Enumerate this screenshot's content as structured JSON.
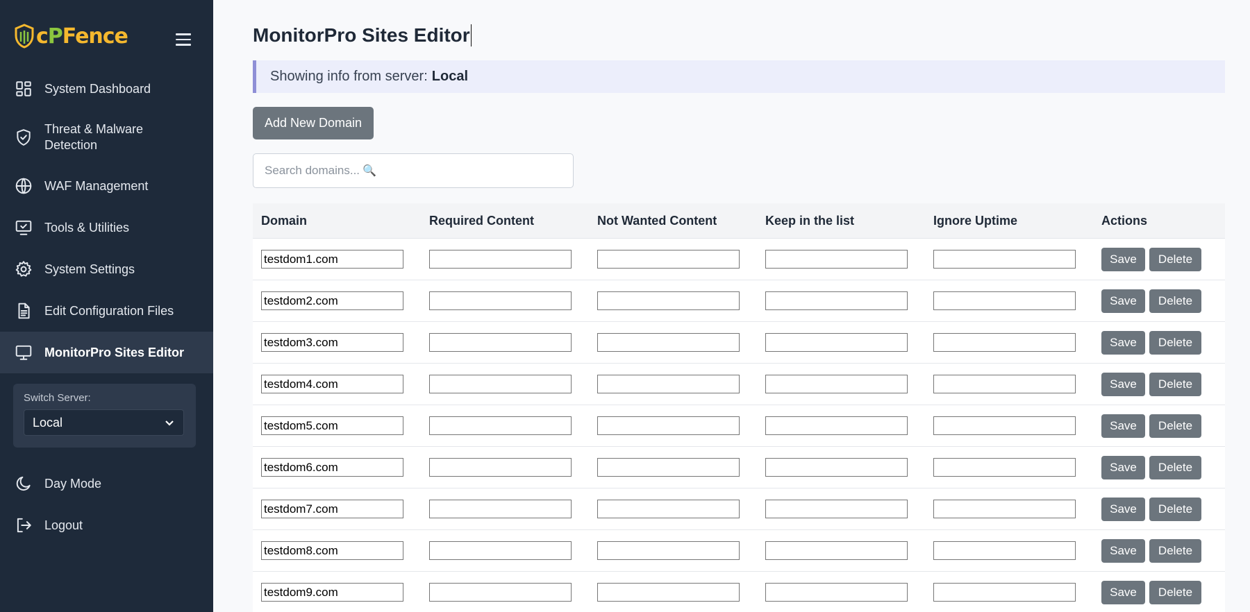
{
  "logo": {
    "text_c": "c",
    "text_p": "P",
    "text_rest": "Fence"
  },
  "sidebar": {
    "items": [
      {
        "label": "System Dashboard",
        "icon": "dashboard-icon"
      },
      {
        "label": "Threat & Malware Detection",
        "icon": "shield-check-icon"
      },
      {
        "label": "WAF Management",
        "icon": "globe-icon"
      },
      {
        "label": "Tools & Utilities",
        "icon": "monitor-check-icon"
      },
      {
        "label": "System Settings",
        "icon": "gear-icon"
      },
      {
        "label": "Edit Configuration Files",
        "icon": "file-text-icon"
      },
      {
        "label": "MonitorPro Sites Editor",
        "icon": "monitor-icon",
        "active": true
      }
    ],
    "switch_server": {
      "label": "Switch Server:",
      "selected": "Local"
    },
    "bottom_items": [
      {
        "label": "Day Mode",
        "icon": "moon-icon"
      },
      {
        "label": "Logout",
        "icon": "logout-icon"
      }
    ]
  },
  "main": {
    "title": "MonitorPro Sites Editor",
    "info_prefix": "Showing info from server:",
    "info_server": "Local",
    "add_button": "Add New Domain",
    "search_placeholder": "Search domains...",
    "search_icon": "🔍",
    "columns": [
      "Domain",
      "Required Content",
      "Not Wanted Content",
      "Keep in the list",
      "Ignore Uptime",
      "Actions"
    ],
    "rows": [
      {
        "domain": "testdom1.com",
        "required": "",
        "not_wanted": "",
        "keep": "",
        "ignore": ""
      },
      {
        "domain": "testdom2.com",
        "required": "",
        "not_wanted": "",
        "keep": "",
        "ignore": ""
      },
      {
        "domain": "testdom3.com",
        "required": "",
        "not_wanted": "",
        "keep": "",
        "ignore": ""
      },
      {
        "domain": "testdom4.com",
        "required": "",
        "not_wanted": "",
        "keep": "",
        "ignore": ""
      },
      {
        "domain": "testdom5.com",
        "required": "",
        "not_wanted": "",
        "keep": "",
        "ignore": ""
      },
      {
        "domain": "testdom6.com",
        "required": "",
        "not_wanted": "",
        "keep": "",
        "ignore": ""
      },
      {
        "domain": "testdom7.com",
        "required": "",
        "not_wanted": "",
        "keep": "",
        "ignore": ""
      },
      {
        "domain": "testdom8.com",
        "required": "",
        "not_wanted": "",
        "keep": "",
        "ignore": ""
      },
      {
        "domain": "testdom9.com",
        "required": "",
        "not_wanted": "",
        "keep": "",
        "ignore": ""
      }
    ],
    "save_label": "Save",
    "delete_label": "Delete"
  }
}
